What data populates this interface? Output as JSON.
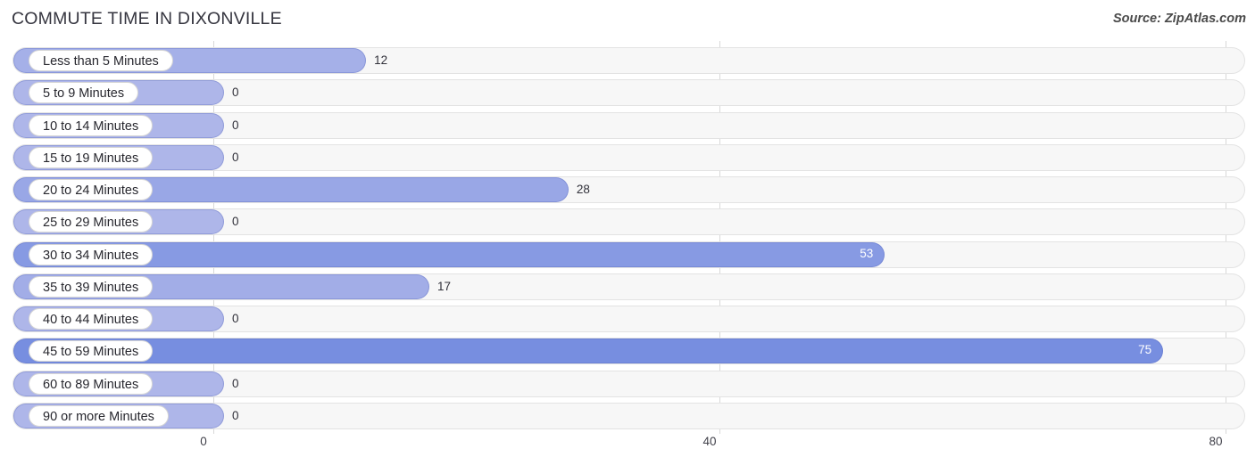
{
  "header": {
    "title": "COMMUTE TIME IN DIXONVILLE",
    "source": "Source: ZipAtlas.com"
  },
  "colors": {
    "bar_low": "#aab4e8",
    "bar_mid": "#8b9ce0",
    "bar_high": "#7b91e0",
    "track": "#f7f7f7",
    "track_border": "#e3e3e3",
    "grid": "#d8d8d8",
    "value_text": "#31313a",
    "value_text_inside": "#ffffff",
    "title_text": "#35353f"
  },
  "chart_data": {
    "type": "bar",
    "orientation": "horizontal",
    "title": "COMMUTE TIME IN DIXONVILLE",
    "xlabel": "",
    "ylabel": "",
    "xlim": [
      0,
      80
    ],
    "grid": true,
    "legend": "none",
    "xticks": [
      "0",
      "40",
      "80"
    ],
    "xtick_values": [
      0,
      40,
      80
    ],
    "categories": [
      "Less than 5 Minutes",
      "5 to 9 Minutes",
      "10 to 14 Minutes",
      "15 to 19 Minutes",
      "20 to 24 Minutes",
      "25 to 29 Minutes",
      "30 to 34 Minutes",
      "35 to 39 Minutes",
      "40 to 44 Minutes",
      "45 to 59 Minutes",
      "60 to 89 Minutes",
      "90 or more Minutes"
    ],
    "values": [
      12,
      0,
      0,
      0,
      28,
      0,
      53,
      17,
      0,
      75,
      0,
      0
    ],
    "value_labels": [
      "12",
      "0",
      "0",
      "0",
      "28",
      "0",
      "53",
      "17",
      "0",
      "75",
      "0",
      "0"
    ]
  }
}
